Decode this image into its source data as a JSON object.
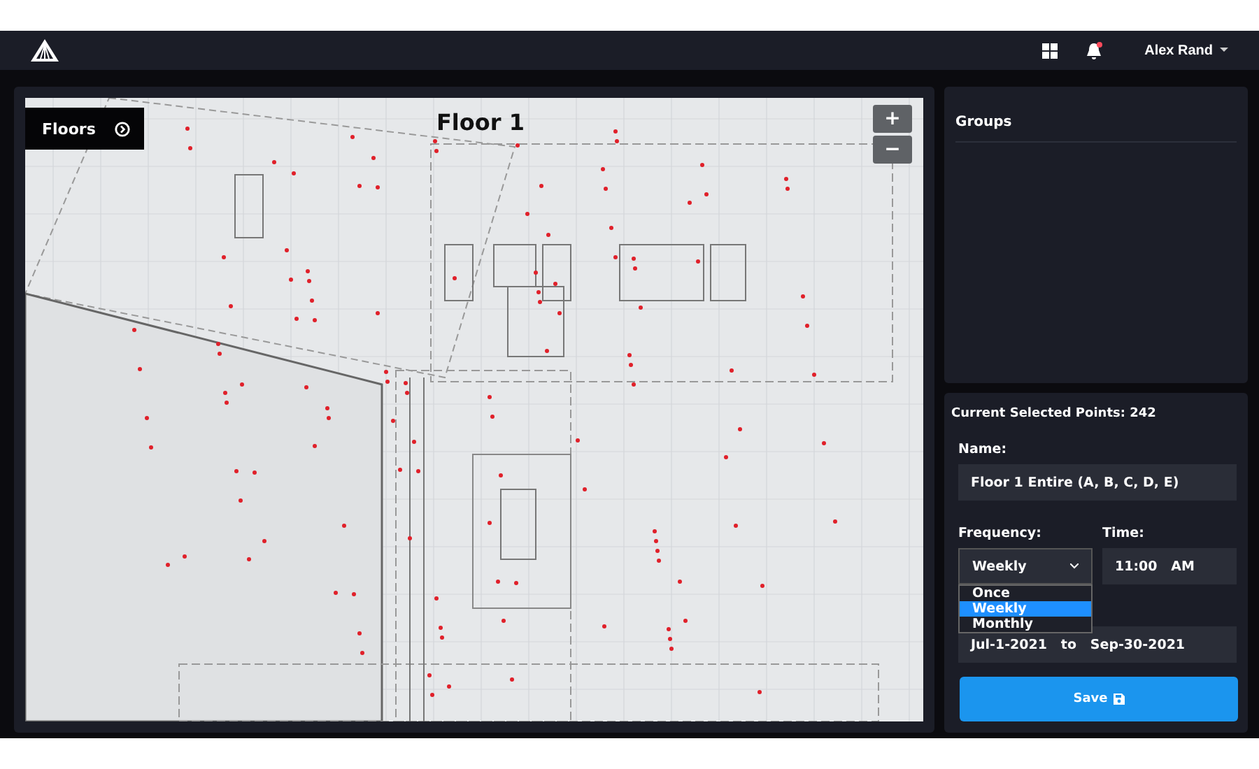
{
  "topbar": {
    "user": "Alex Rand",
    "notification": true
  },
  "map": {
    "floors_button": "Floors",
    "title": "Floor 1",
    "zoom_in": "+",
    "zoom_out": "−"
  },
  "groups": {
    "title": "Groups"
  },
  "schedule": {
    "selected_points": "Current Selected Points: 242",
    "name_label": "Name:",
    "name_value": "Floor 1 Entire (A, B, C, D, E)",
    "frequency_label": "Frequency:",
    "frequency_value": "Weekly",
    "frequency_open": true,
    "frequency_options": [
      {
        "label": "Once",
        "selected": false
      },
      {
        "label": "Weekly",
        "selected": true
      },
      {
        "label": "Monthly",
        "selected": false
      }
    ],
    "time_label": "Time:",
    "time_value": "11:00   AM",
    "date_range": "Jul-1-2021   to   Sep-30-2021",
    "save": "Save"
  }
}
